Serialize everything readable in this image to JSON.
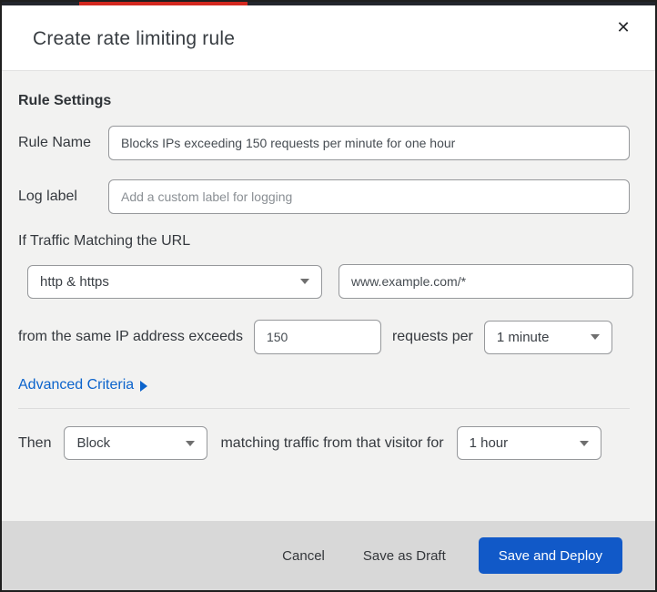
{
  "modal": {
    "title": "Create rate limiting rule",
    "close_icon": "✕"
  },
  "rule_settings": {
    "heading": "Rule Settings",
    "rule_name": {
      "label": "Rule Name",
      "value": "Blocks IPs exceeding 150 requests per minute for one hour"
    },
    "log_label": {
      "label": "Log label",
      "placeholder": "Add a custom label for logging"
    }
  },
  "traffic_match": {
    "heading": "If Traffic Matching the URL",
    "scheme_select": {
      "value": "http & https"
    },
    "url_input": {
      "value": "www.example.com/*"
    },
    "threshold": {
      "prefix": "from the same IP address exceeds",
      "requests_value": "150",
      "middle": "requests per",
      "period_select": {
        "value": "1 minute"
      }
    },
    "advanced_criteria_label": "Advanced Criteria"
  },
  "action": {
    "then_label": "Then",
    "action_select": {
      "value": "Block"
    },
    "middle_text": "matching traffic from that visitor for",
    "duration_select": {
      "value": "1 hour"
    }
  },
  "footer": {
    "cancel_label": "Cancel",
    "save_draft_label": "Save as Draft",
    "save_deploy_label": "Save and Deploy"
  },
  "colors": {
    "primary_button_blue": "#1159c8",
    "link_blue": "#0b63cc",
    "body_background": "#f2f2f1",
    "footer_background": "#d8d8d8",
    "top_strip_dark": "#23262d",
    "top_strip_red": "#d3281f",
    "input_border": "#96989b"
  }
}
